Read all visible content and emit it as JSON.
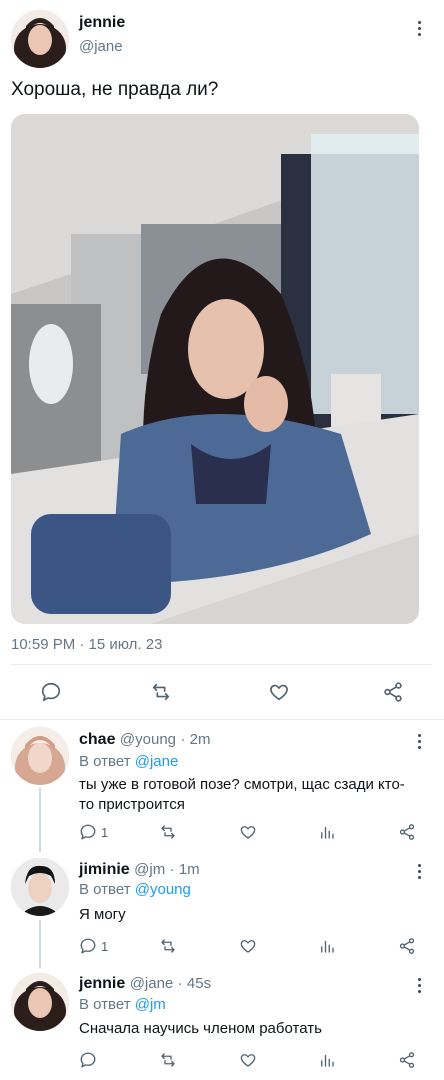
{
  "tweet": {
    "name": "jennie",
    "handle": "@jane",
    "text": "Хороша, не правда ли?",
    "timestamp": "10:59 PM · 15 июл. 23"
  },
  "replies": [
    {
      "name": "chae",
      "handle": "@young",
      "time": "· 2m",
      "reply_prefix": "В ответ",
      "reply_to": "@jane",
      "text": "ты уже в готовой позе? смотри, щас сзади кто-то пристроится",
      "reply_count": "1"
    },
    {
      "name": "jiminie",
      "handle": "@jm",
      "time": "· 1m",
      "reply_prefix": "В ответ",
      "reply_to": "@young",
      "text": "Я могу",
      "reply_count": "1"
    },
    {
      "name": "jennie",
      "handle": "@jane",
      "time": "· 45s",
      "reply_prefix": "В ответ",
      "reply_to": "@jm",
      "text": "Сначала научись членом работать",
      "reply_count": ""
    }
  ],
  "icons": {
    "reply": "comment-icon",
    "retweet": "retweet-icon",
    "like": "heart-icon",
    "views": "bar-chart-icon",
    "share": "share-icon",
    "more": "more-vertical-icon"
  },
  "colors": {
    "link": "#1d9bf0",
    "muted": "#657786",
    "divider": "#e6ecf0"
  }
}
